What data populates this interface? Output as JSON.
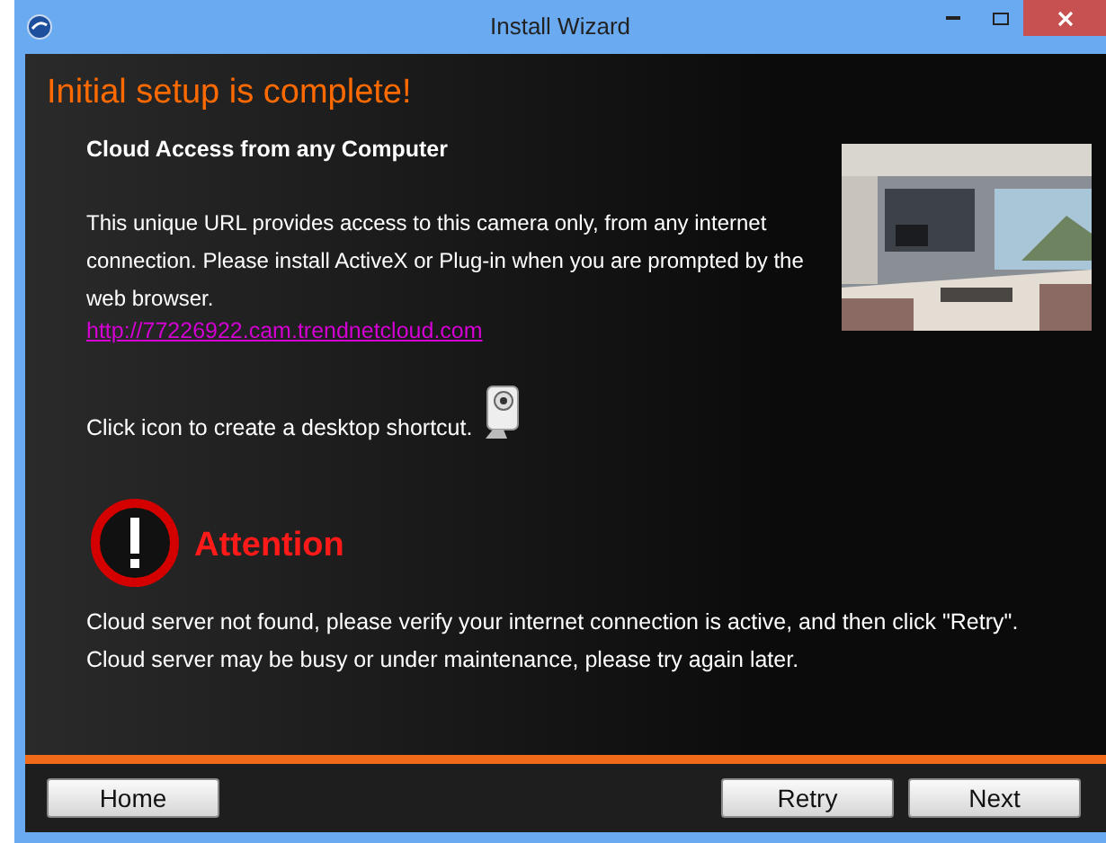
{
  "window": {
    "title": "Install Wizard"
  },
  "heading": "Initial setup is complete!",
  "section_title": "Cloud Access from any Computer",
  "description": "This unique URL provides access to this camera only, from any internet connection. Please install ActiveX or Plug-in when you are prompted by the web browser.",
  "url": "http://77226922.cam.trendnetcloud.com",
  "shortcut_text": "Click icon to create a desktop shortcut.",
  "attention": {
    "title": "Attention",
    "messages": [
      "Cloud server not found, please verify your internet connection is active, and then click \"Retry\".",
      "Cloud server may be busy or under maintenance, please try again later."
    ]
  },
  "buttons": {
    "left": [
      "Home"
    ],
    "right": [
      "Retry",
      "Next"
    ]
  }
}
